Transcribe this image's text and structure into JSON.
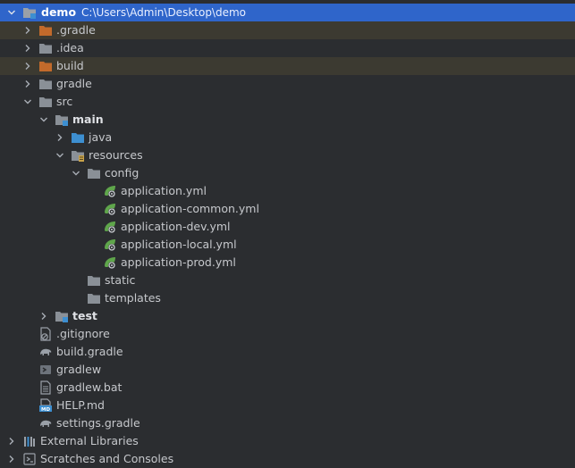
{
  "project": {
    "name": "demo",
    "path": "C:\\Users\\Admin\\Desktop\\demo"
  },
  "items": {
    "gradle_hidden": ".gradle",
    "idea": ".idea",
    "build_dir": "build",
    "gradle_dir": "gradle",
    "src": "src",
    "main": "main",
    "java": "java",
    "resources": "resources",
    "config": "config",
    "app_yml": "application.yml",
    "app_common_yml": "application-common.yml",
    "app_dev_yml": "application-dev.yml",
    "app_local_yml": "application-local.yml",
    "app_prod_yml": "application-prod.yml",
    "static": "static",
    "templates": "templates",
    "test": "test",
    "gitignore": ".gitignore",
    "build_gradle": "build.gradle",
    "gradlew": "gradlew",
    "gradlew_bat": "gradlew.bat",
    "help_md": "HELP.md",
    "settings_gradle": "settings.gradle",
    "external_libraries": "External Libraries",
    "scratches": "Scratches and Consoles"
  },
  "colors": {
    "background": "#2b2d30",
    "selection": "#2f65ca",
    "excluded_row": "#3c3a31",
    "folder": "#8a9097",
    "excluded_folder": "#c26a2b",
    "source_folder": "#3d8fd1",
    "spring_leaf": "#5fa64b"
  }
}
